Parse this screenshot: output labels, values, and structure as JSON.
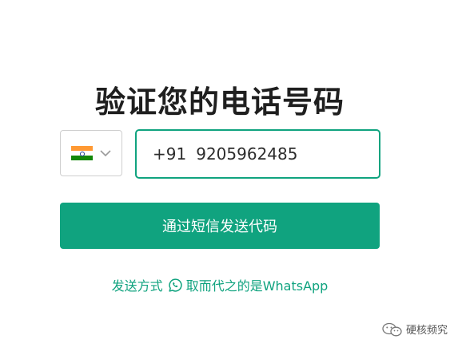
{
  "page": {
    "title": "验证您的电话号码"
  },
  "country_select": {
    "flag_icon": "india-flag-icon",
    "chevron_icon": "chevron-down-icon",
    "colors": {
      "saffron": "#ff9933",
      "white": "#ffffff",
      "green": "#138808",
      "chakra": "#1a3a8f"
    }
  },
  "phone_input": {
    "dial_code": "+91",
    "number": "9205962485"
  },
  "submit_button": {
    "label": "通过短信发送代码"
  },
  "alternative": {
    "prefix": "发送方式",
    "icon": "whatsapp-icon",
    "suffix": "取而代之的是WhatsApp"
  },
  "watermark": {
    "icon": "wechat-icon",
    "text": "硬核频究"
  },
  "colors": {
    "accent": "#10a37f",
    "title": "#1f1f1f",
    "border": "#cfcfcf"
  }
}
